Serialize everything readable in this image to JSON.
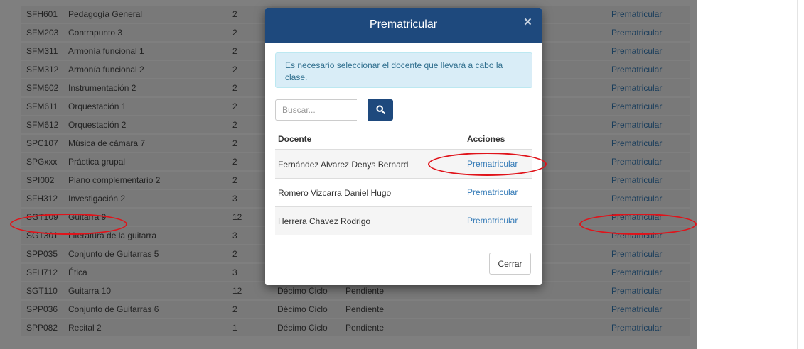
{
  "courses": [
    {
      "code": "SFH601",
      "name": "Pedagogía General",
      "credits": "2",
      "ciclo": "",
      "estado": "",
      "action": "Prematricular"
    },
    {
      "code": "SFM203",
      "name": "Contrapunto 3",
      "credits": "2",
      "ciclo": "",
      "estado": "",
      "action": "Prematricular"
    },
    {
      "code": "SFM311",
      "name": "Armonía funcional 1",
      "credits": "2",
      "ciclo": "",
      "estado": "",
      "action": "Prematricular"
    },
    {
      "code": "SFM312",
      "name": "Armonía funcional 2",
      "credits": "2",
      "ciclo": "",
      "estado": "",
      "action": "Prematricular"
    },
    {
      "code": "SFM602",
      "name": "Instrumentación 2",
      "credits": "2",
      "ciclo": "",
      "estado": "",
      "action": "Prematricular"
    },
    {
      "code": "SFM611",
      "name": "Orquestación 1",
      "credits": "2",
      "ciclo": "",
      "estado": "",
      "action": "Prematricular"
    },
    {
      "code": "SFM612",
      "name": "Orquestación 2",
      "credits": "2",
      "ciclo": "",
      "estado": "",
      "action": "Prematricular"
    },
    {
      "code": "SPC107",
      "name": "Música de cámara 7",
      "credits": "2",
      "ciclo": "",
      "estado": "",
      "action": "Prematricular"
    },
    {
      "code": "SPGxxx",
      "name": "Práctica grupal",
      "credits": "2",
      "ciclo": "",
      "estado": "",
      "action": "Prematricular"
    },
    {
      "code": "SPI002",
      "name": "Piano complementario 2",
      "credits": "2",
      "ciclo": "",
      "estado": "",
      "action": "Prematricular"
    },
    {
      "code": "SFH312",
      "name": "Investigación 2",
      "credits": "3",
      "ciclo": "",
      "estado": "",
      "action": "Prematricular"
    },
    {
      "code": "SGT109",
      "name": "Guitarra 9",
      "credits": "12",
      "ciclo": "",
      "estado": "",
      "action": "Prematricular"
    },
    {
      "code": "SGT301",
      "name": "Literatura de la guitarra",
      "credits": "3",
      "ciclo": "",
      "estado": "",
      "action": "Prematricular"
    },
    {
      "code": "SPP035",
      "name": "Conjunto de Guitarras 5",
      "credits": "2",
      "ciclo": "",
      "estado": "",
      "action": "Prematricular"
    },
    {
      "code": "SFH712",
      "name": "Ética",
      "credits": "3",
      "ciclo": "",
      "estado": "",
      "action": "Prematricular"
    },
    {
      "code": "SGT110",
      "name": "Guitarra 10",
      "credits": "12",
      "ciclo": "Décimo Ciclo",
      "estado": "Pendiente",
      "action": "Prematricular"
    },
    {
      "code": "SPP036",
      "name": "Conjunto de Guitarras 6",
      "credits": "2",
      "ciclo": "Décimo Ciclo",
      "estado": "Pendiente",
      "action": "Prematricular"
    },
    {
      "code": "SPP082",
      "name": "Recital 2",
      "credits": "1",
      "ciclo": "Décimo Ciclo",
      "estado": "Pendiente",
      "action": "Prematricular"
    }
  ],
  "modal": {
    "title": "Prematricular",
    "close_symbol": "×",
    "alert_text": "Es necesario seleccionar el docente que llevará a cabo la clase.",
    "search_placeholder": "Buscar...",
    "search_value": "",
    "col_docente": "Docente",
    "col_acciones": "Acciones",
    "docentes": [
      {
        "name": "Fernández Alvarez Denys Bernard",
        "action": "Prematricular"
      },
      {
        "name": "Romero Vizcarra Daniel Hugo",
        "action": "Prematricular"
      },
      {
        "name": "Herrera Chavez Rodrigo",
        "action": "Prematricular"
      }
    ],
    "close_button": "Cerrar"
  },
  "colors": {
    "primary": "#1e497d",
    "link": "#337ab7",
    "alert_bg": "#d9edf7",
    "alert_text": "#31708f",
    "annotation": "#e0131a"
  },
  "icons": {
    "search": "search-icon",
    "close": "close-icon"
  }
}
